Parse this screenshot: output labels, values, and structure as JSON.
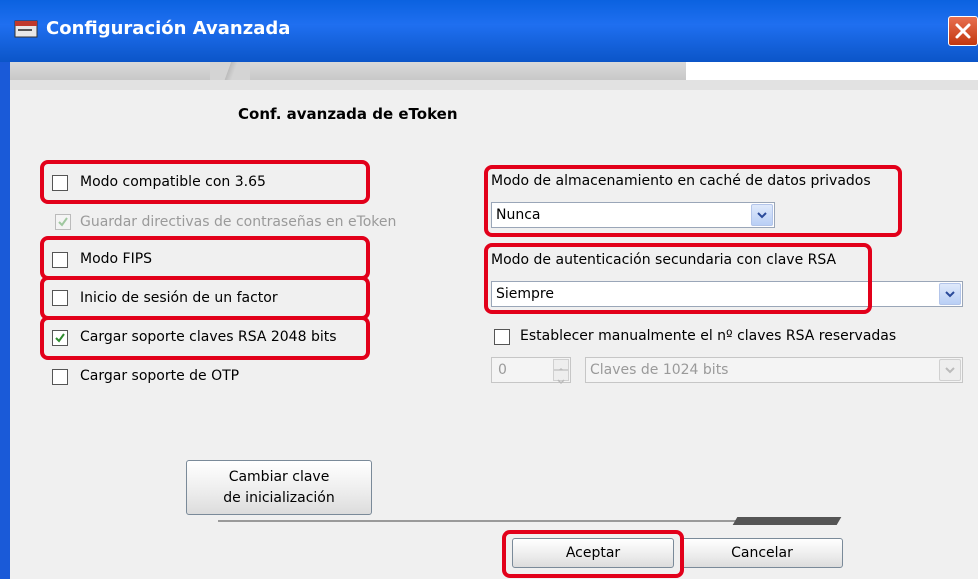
{
  "window": {
    "title": "Configuración Avanzada",
    "accent_color": "#0b62e0",
    "highlight_color": "#e2001a"
  },
  "heading": "Conf. avanzada de eToken",
  "options": {
    "compat_365": {
      "label": "Modo compatible con 3.65",
      "checked": false
    },
    "save_policies": {
      "label": "Guardar directivas de contraseñas en eToken",
      "checked": true,
      "disabled": true
    },
    "fips": {
      "label": "Modo FIPS",
      "checked": false
    },
    "single_factor": {
      "label": "Inicio de sesión de un factor",
      "checked": false
    },
    "rsa_2048": {
      "label": "Cargar soporte claves RSA 2048 bits",
      "checked": true
    },
    "otp": {
      "label": "Cargar soporte de OTP",
      "checked": false
    }
  },
  "cache_mode": {
    "label": "Modo de almacenamiento en caché de datos privados",
    "value": "Nunca"
  },
  "secondary_auth": {
    "label": "Modo de autenticación secundaria con clave RSA",
    "value": "Siempre"
  },
  "manual_rsa": {
    "label": "Establecer manualmente el nº claves RSA reservadas",
    "checked": false,
    "count_value": "0",
    "key_type_value": "Claves de 1024 bits"
  },
  "buttons": {
    "change_init_key_line1": "Cambiar clave",
    "change_init_key_line2": "de inicialización",
    "accept": "Aceptar",
    "cancel": "Cancelar"
  },
  "icons": [
    "app-window-icon",
    "close-icon",
    "checkmark-icon",
    "dropdown-arrow-icon",
    "spinner-up-icon",
    "spinner-down-icon"
  ]
}
